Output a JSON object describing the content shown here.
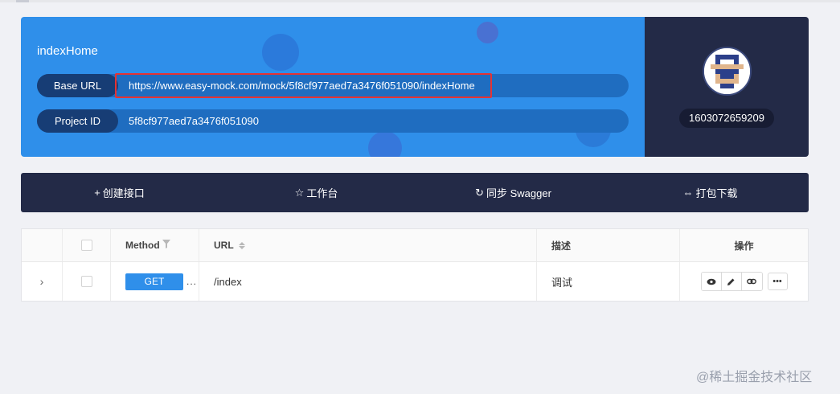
{
  "project": {
    "name": "indexHome",
    "base_url_label": "Base URL",
    "base_url": "https://www.easy-mock.com/mock/5f8cf977aed7a3476f051090/indexHome",
    "project_id_label": "Project ID",
    "project_id": "5f8cf977aed7a3476f051090"
  },
  "user": {
    "id": "1603072659209"
  },
  "toolbar": {
    "items": [
      {
        "icon": "+",
        "label": "创建接口"
      },
      {
        "icon": "☆",
        "label": "工作台"
      },
      {
        "icon": "↻",
        "label": "同步 Swagger"
      },
      {
        "icon": "⇔",
        "label": "打包下载"
      }
    ]
  },
  "table": {
    "headers": {
      "method": "Method",
      "url": "URL",
      "desc": "描述",
      "ops": "操作"
    },
    "rows": [
      {
        "method": "GET",
        "ellipsis": "...",
        "url": "/index",
        "desc": "调试"
      }
    ]
  },
  "watermark": "@稀土掘金技术社区",
  "colors": {
    "accent": "#2f8fea",
    "dark": "#232a47",
    "highlight": "#e53333"
  }
}
